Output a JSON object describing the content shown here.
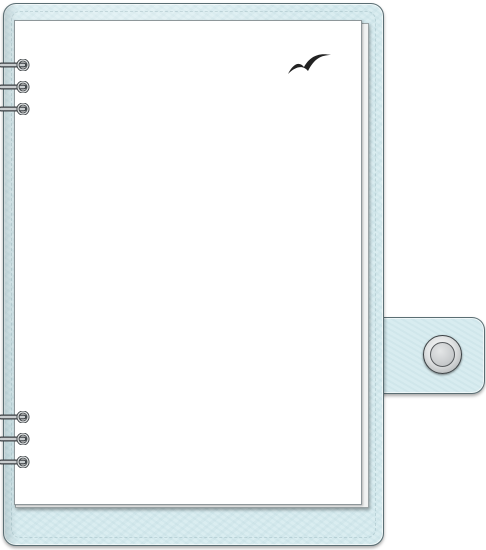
{
  "binder": {
    "cover_color": "#d6ebef",
    "cover_border_color": "#5a6e73",
    "paper_color": "#ffffff"
  },
  "logo": {
    "icon": "seagull-logo-icon",
    "color": "#222222"
  },
  "clasp": {
    "icon": "snap-button-icon"
  },
  "rings": {
    "icon": "binder-ring-icon",
    "top_count": 3,
    "bottom_count": 3
  }
}
